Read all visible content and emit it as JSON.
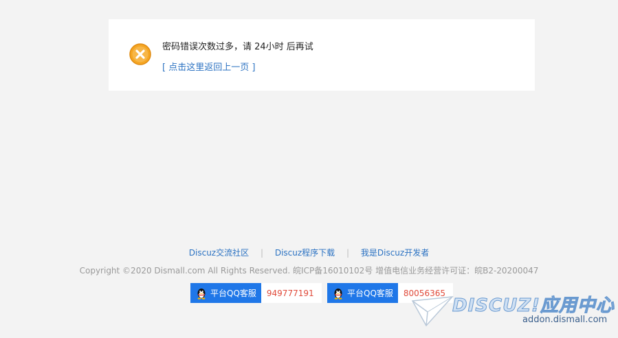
{
  "message": {
    "text": "密码错误次数过多，请 24小时 后再试",
    "back_link": "[ 点击这里返回上一页 ]",
    "icon": "error-x-icon",
    "icon_color": "#f5a623"
  },
  "footer": {
    "links": [
      "Discuz交流社区",
      "Discuz程序下载",
      "我是Discuz开发者"
    ],
    "separator": "|",
    "copyright": "Copyright ©2020 Dismall.com All Rights Reserved.  皖ICP备16010102号   增值电信业务经营许可证：皖B2-20200047",
    "qq": [
      {
        "label": "平台QQ客服",
        "number": "949777191"
      },
      {
        "label": "平台QQ客服",
        "number": "80056365"
      }
    ]
  },
  "watermark": {
    "logo": "DISCUZ!应用中心",
    "site": "addon.dismall.com"
  },
  "colors": {
    "link": "#2b72c2",
    "qq_button": "#1f77e8",
    "qq_number": "#e04a3a",
    "background": "#f3f3f3"
  }
}
